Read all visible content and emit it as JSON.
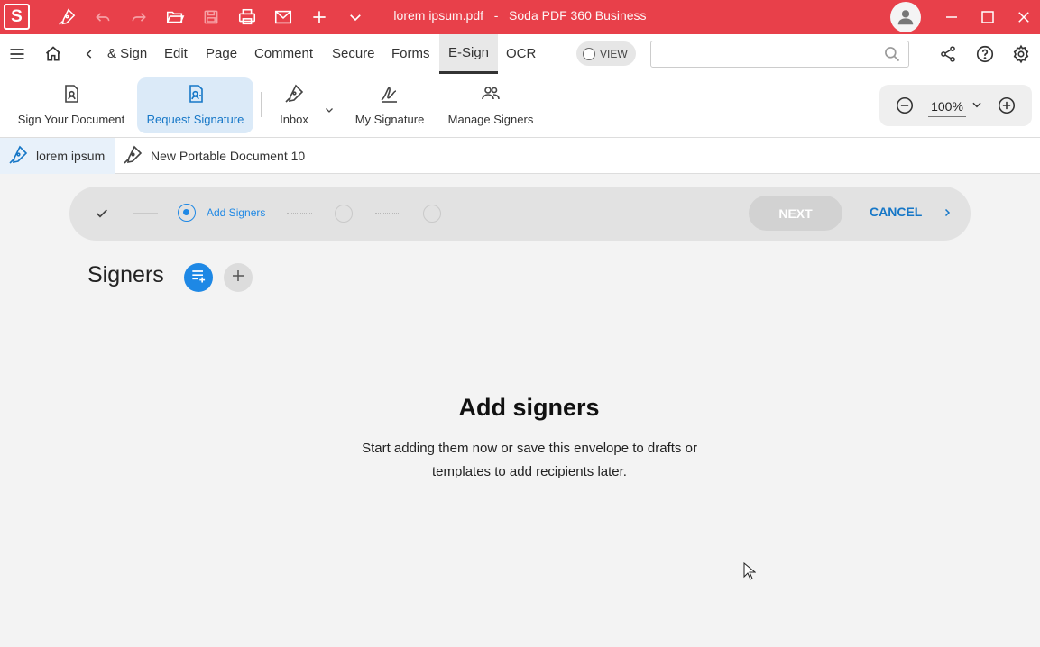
{
  "titlebar": {
    "logo": "S",
    "filename": "lorem ipsum.pdf",
    "separator": "-",
    "app_name": "Soda PDF 360 Business",
    "bg_color": "#e8404a",
    "icons": [
      "sign-pen-icon",
      "undo-icon",
      "redo-icon",
      "open-folder-icon",
      "save-icon",
      "print-icon",
      "email-icon",
      "new-plus-icon",
      "customize-chevron-icon",
      "user-icon",
      "minimize-icon",
      "maximize-icon",
      "close-icon"
    ]
  },
  "menubar": {
    "items": [
      "& Sign",
      "Edit",
      "Page",
      "Comment",
      "Secure",
      "Forms",
      "E-Sign",
      "OCR"
    ],
    "active": "E-Sign",
    "view_toggle": "VIEW",
    "search_placeholder": ""
  },
  "ribbon": {
    "buttons": [
      {
        "label": "Sign Your Document",
        "icon": "sign-document-icon"
      },
      {
        "label": "Request Signature",
        "icon": "request-signature-icon",
        "selected": true
      },
      {
        "label": "Inbox",
        "icon": "pen-nib-icon"
      },
      {
        "label": "My Signature",
        "icon": "signature-icon"
      },
      {
        "label": "Manage Signers",
        "icon": "people-icon"
      }
    ],
    "zoom": "100%"
  },
  "doctabs": [
    {
      "label": "lorem ipsum",
      "active": true
    },
    {
      "label": "New Portable Document 10",
      "active": false
    }
  ],
  "stepper": {
    "active_step_label": "Add Signers",
    "next_label": "NEXT",
    "cancel_label": "CANCEL",
    "accent_color": "#1e88e5"
  },
  "signers": {
    "title": "Signers",
    "empty_title": "Add signers",
    "empty_desc_line1": "Start adding them now or save this envelope to drafts or",
    "empty_desc_line2": "templates to add recipients later."
  }
}
